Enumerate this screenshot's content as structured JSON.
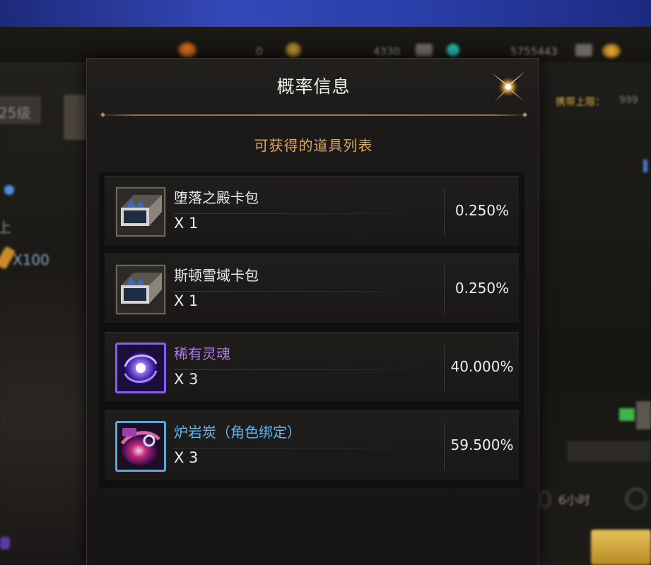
{
  "dialog": {
    "title": "概率信息",
    "subtitle": "可获得的道具列表"
  },
  "colors": {
    "title_text": "#f1efea",
    "subtitle_text": "#d9a760",
    "normal_item": "#ecebe7",
    "rare_item": "#b07be8",
    "bound_item": "#62b6ef",
    "panel_bg": "#1b1a18"
  },
  "items": [
    {
      "name": "堕落之殿卡包",
      "quantity": "X 1",
      "probability": "0.250%",
      "icon": "card-pack-icon",
      "name_color": "#ecebe7"
    },
    {
      "name": "斯顿雪域卡包",
      "quantity": "X 1",
      "probability": "0.250%",
      "icon": "card-pack-icon",
      "name_color": "#ecebe7"
    },
    {
      "name": "稀有灵魂",
      "quantity": "X 3",
      "probability": "40.000%",
      "icon": "rare-soul-icon",
      "name_color": "#b07be8"
    },
    {
      "name": "炉岩炭（角色绑定）",
      "quantity": "X 3",
      "probability": "59.500%",
      "icon": "lava-charcoal-icon",
      "name_color": "#62b6ef"
    }
  ],
  "background": {
    "left_level": "25级",
    "left_on": "上",
    "left_count": "X100",
    "top_value_a": "0",
    "top_value_b": "4330",
    "top_value_c": "5755443",
    "right_cap_label": "携带上限：",
    "right_cap_value": "999",
    "right_time": "6小时"
  }
}
